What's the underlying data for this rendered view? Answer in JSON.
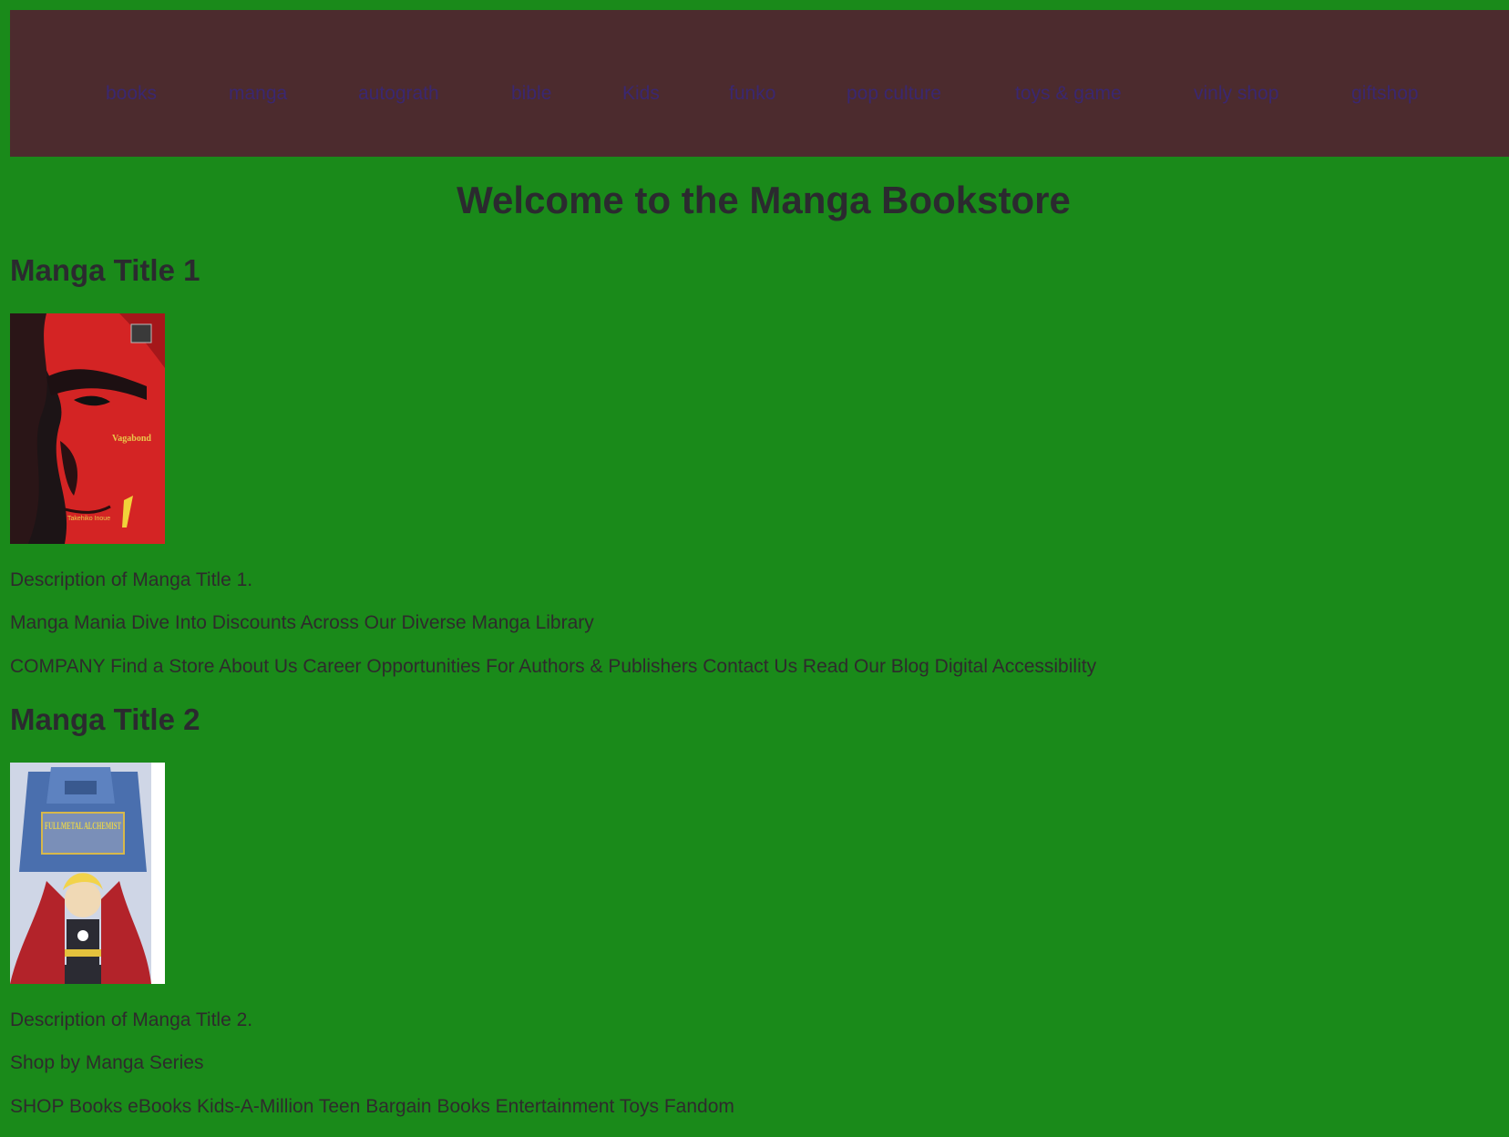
{
  "nav": {
    "items": [
      {
        "label": "books"
      },
      {
        "label": "manga"
      },
      {
        "label": "autograth"
      },
      {
        "label": "bible"
      },
      {
        "label": "Kids"
      },
      {
        "label": "funko"
      },
      {
        "label": "pop culture"
      },
      {
        "label": "toys & game"
      },
      {
        "label": "vinly shop"
      },
      {
        "label": "giftshop"
      }
    ]
  },
  "main": {
    "heading": "Welcome to the Manga Bookstore",
    "mangas": [
      {
        "title": "Manga Title 1",
        "cover_text": "Vagabond",
        "cover_author": "Takehiko Inoue",
        "description": "Description of Manga Title 1."
      },
      {
        "title": "Manga Title 2",
        "cover_text": "FULLMETAL ALCHEMIST",
        "description": "Description of Manga Title 2."
      }
    ],
    "promo_line": "Manga Mania Dive Into Discounts Across Our Diverse Manga Library",
    "company_line": "COMPANY Find a Store About Us Career Opportunities For Authors & Publishers Contact Us Read Our Blog Digital Accessibility",
    "series_line": "Shop by Manga Series",
    "shop_line": "SHOP Books eBooks Kids-A-Million Teen Bargain Books Entertainment Toys Fandom"
  },
  "colors": {
    "page_bg": "#1a8a1a",
    "nav_bg": "#4c2b2e",
    "nav_link": "#3a2770",
    "text": "#2e2a2c"
  }
}
